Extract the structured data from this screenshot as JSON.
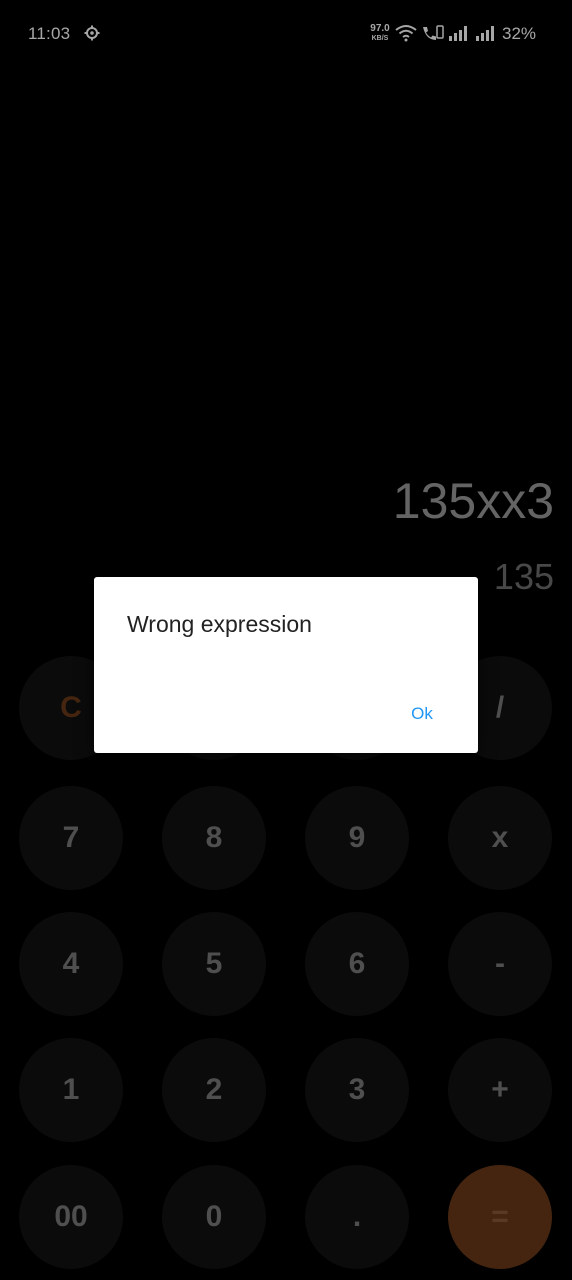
{
  "status_bar": {
    "time": "11:03",
    "net_speed": "97.0",
    "net_speed_unit": "KB/S",
    "battery": "32%",
    "icons": [
      "gear-icon",
      "wifi-icon",
      "volte-call-icon",
      "signal-icon",
      "signal-icon"
    ]
  },
  "display": {
    "expression": "135xx3",
    "result": "135"
  },
  "keypad": {
    "rows": [
      [
        "C",
        "",
        "",
        "/"
      ],
      [
        "7",
        "8",
        "9",
        "x"
      ],
      [
        "4",
        "5",
        "6",
        "-"
      ],
      [
        "1",
        "2",
        "3",
        "+"
      ],
      [
        "00",
        "0",
        ".",
        "="
      ]
    ]
  },
  "dialog": {
    "message": "Wrong expression",
    "ok_label": "Ok",
    "ok_color": "#2196f3"
  },
  "colors": {
    "background": "#000000",
    "key_background": "#121212",
    "accent": "#6b3a17"
  }
}
